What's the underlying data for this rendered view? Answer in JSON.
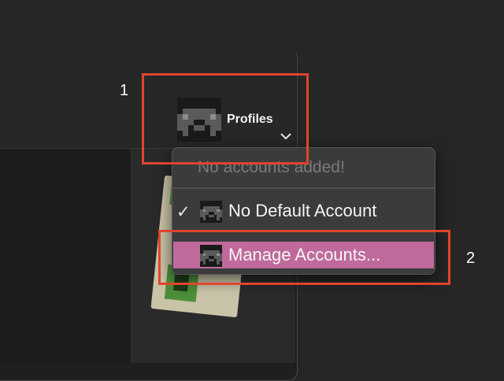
{
  "annotations": {
    "callout_1": "1",
    "callout_2": "2",
    "box_color": "#e0452d"
  },
  "toolbar": {
    "profiles_label": "Profiles",
    "avatar_icon": "steve-head-icon",
    "chevron_icon": "chevron-down-icon"
  },
  "profiles_menu": {
    "header": "No accounts added!",
    "items": [
      {
        "label": "No Default Account",
        "checked": true,
        "icon": "steve-head-icon"
      },
      {
        "label": "Manage Accounts...",
        "checked": false,
        "icon": "steve-head-icon",
        "highlighted": true
      }
    ],
    "check_glyph": "✓",
    "highlight_color": "#c06a9b"
  }
}
